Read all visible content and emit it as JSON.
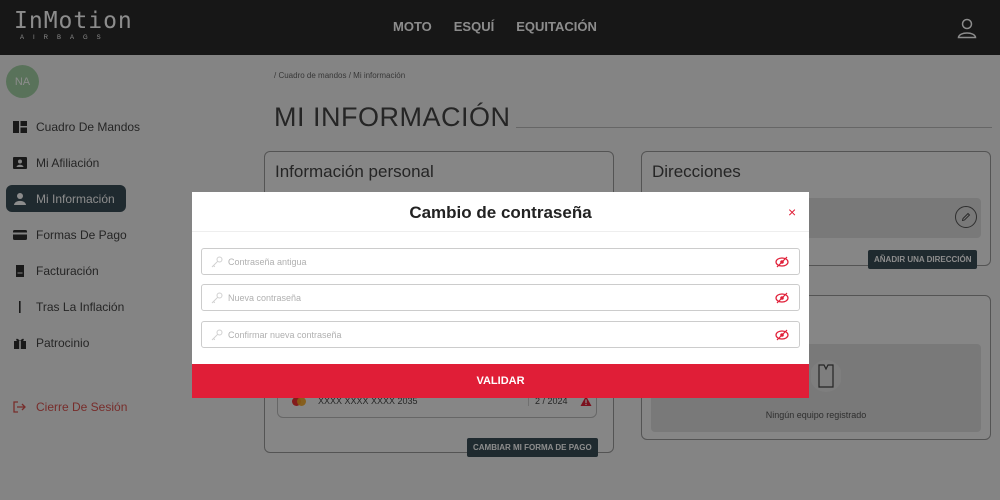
{
  "header": {
    "logo_main": "InMotion",
    "logo_sub": "AIRBAGS",
    "nav": [
      "MOTO",
      "ESQUÍ",
      "EQUITACIÓN"
    ],
    "user_icon": "user-icon"
  },
  "sidebar": {
    "avatar_initials": "NA",
    "items": [
      {
        "label": "Cuadro De Mandos",
        "icon": "dashboard-icon"
      },
      {
        "label": "Mi Afiliación",
        "icon": "id-card-icon"
      },
      {
        "label": "Mi Información",
        "icon": "person-icon",
        "active": true
      },
      {
        "label": "Formas De Pago",
        "icon": "credit-card-icon"
      },
      {
        "label": "Facturación",
        "icon": "document-icon"
      },
      {
        "label": "Tras La Inflación",
        "icon": "bar-icon"
      },
      {
        "label": "Patrocinio",
        "icon": "gift-icon"
      }
    ],
    "logout_label": "Cierre De Sesión"
  },
  "main": {
    "breadcrumb": "/ Cuadro de mandos / Mi información",
    "page_title": "MI INFORMACIÓN",
    "personal_card": {
      "title": "Información personal",
      "payment": {
        "number": "XXXX XXXX XXXX 2035",
        "expiry": "2 / 2024"
      },
      "change_payment_button": "CAMBIAR MI FORMA DE PAGO"
    },
    "address_card": {
      "title": "Direcciones",
      "add_button": "AÑADIR UNA DIRECCIÓN"
    },
    "equipment_card": {
      "empty_text": "Ningún equipo registrado"
    }
  },
  "modal": {
    "title": "Cambio de contraseña",
    "close_symbol": "×",
    "fields": [
      {
        "placeholder": "Contraseña antigua",
        "value": ""
      },
      {
        "placeholder": "Nueva contraseña",
        "value": ""
      },
      {
        "placeholder": "Confirmar nueva contraseña",
        "value": ""
      }
    ],
    "submit_label": "VALIDAR"
  },
  "colors": {
    "header_bg": "#2b2b2b",
    "active_nav": "#3a4d56",
    "accent_red": "#e01e37",
    "avatar_green": "#a3d0a5"
  }
}
